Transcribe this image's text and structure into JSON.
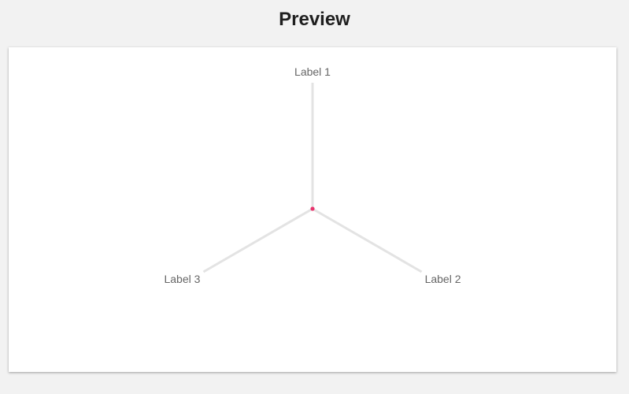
{
  "page": {
    "title": "Preview"
  },
  "chart_data": {
    "type": "radar",
    "axes": [
      "Label 1",
      "Label 2",
      "Label 3"
    ],
    "series": [
      {
        "values": [
          0,
          0,
          0
        ],
        "color": "#e8336d"
      }
    ],
    "colors": {
      "axis": "#e3e3e3",
      "label": "#666666",
      "point": "#e8336d"
    }
  }
}
